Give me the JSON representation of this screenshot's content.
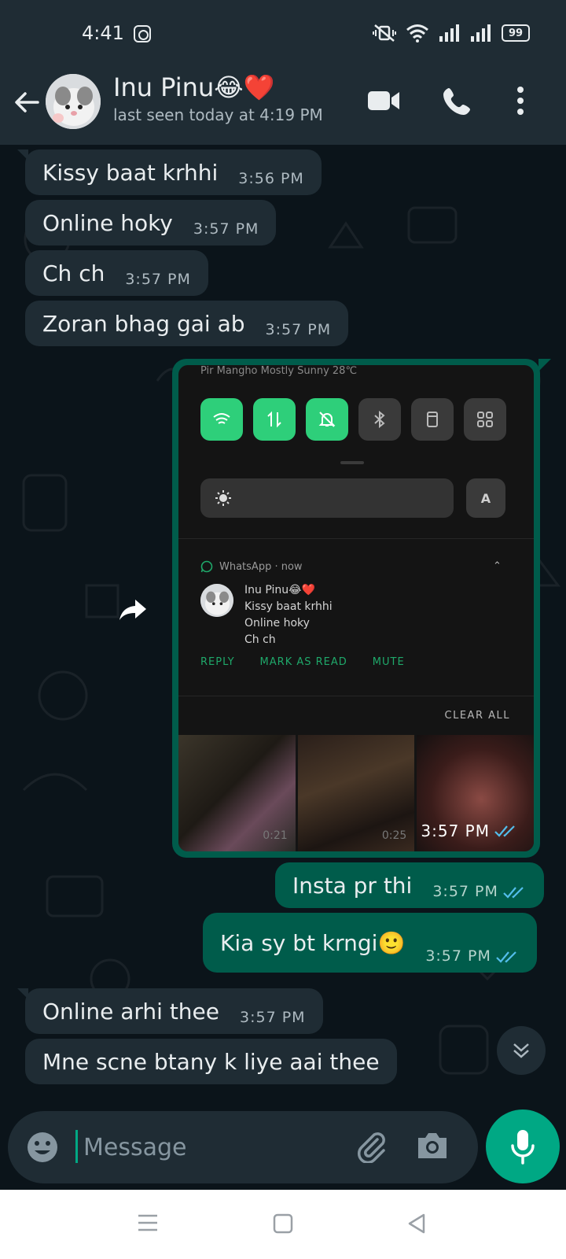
{
  "status_bar": {
    "time": "4:41",
    "battery": "99",
    "icons": [
      "instagram-icon",
      "mute-vibrate-icon",
      "wifi-icon",
      "signal-icon",
      "signal-icon",
      "battery-icon"
    ]
  },
  "header": {
    "contact_name": "Inu Pinu😂❤️",
    "last_seen": "last seen today at 4:19 PM",
    "icons": [
      "back-arrow-icon",
      "video-call-icon",
      "voice-call-icon",
      "more-options-icon"
    ]
  },
  "messages": [
    {
      "dir": "in",
      "text": "Kissy baat krhhi",
      "time": "3:56 PM"
    },
    {
      "dir": "in",
      "text": "Online hoky",
      "time": "3:57 PM"
    },
    {
      "dir": "in",
      "text": "Ch ch",
      "time": "3:57 PM"
    },
    {
      "dir": "in",
      "text": "Zoran bhag gai ab",
      "time": "3:57 PM"
    },
    {
      "dir": "out",
      "type": "image",
      "time": "3:57 PM",
      "screenshot": {
        "weather": "Pir Mangho Mostly Sunny 28℃",
        "auto_label": "A",
        "notification": {
          "app": "WhatsApp · now",
          "sender": "Inu Pinu😂❤️",
          "lines": [
            "Kissy baat krhhi",
            "Online hoky",
            "Ch ch"
          ],
          "actions": [
            "REPLY",
            "MARK AS READ",
            "MUTE"
          ]
        },
        "clear_all": "CLEAR ALL",
        "thumb_durations": [
          "0:21",
          "0:25",
          ""
        ]
      }
    },
    {
      "dir": "out",
      "text": "Insta pr thi",
      "time": "3:57 PM"
    },
    {
      "dir": "out",
      "text": "Kia sy bt krngi🙂",
      "time": "3:57 PM"
    },
    {
      "dir": "in",
      "text": "Online arhi thee",
      "time": "3:57 PM"
    },
    {
      "dir": "in",
      "text": "Mne scne btany k liye aai thee",
      "time": ""
    }
  ],
  "composer": {
    "placeholder": "Message",
    "icons": [
      "emoji-icon",
      "attach-icon",
      "camera-icon",
      "mic-icon"
    ]
  },
  "colors": {
    "chat_bg": "#0b141a",
    "bar_bg": "#1f2c34",
    "incoming_bubble": "#1f2c34",
    "outgoing_bubble": "#005c4b",
    "accent": "#00a884",
    "read_ticks": "#53bdeb"
  }
}
